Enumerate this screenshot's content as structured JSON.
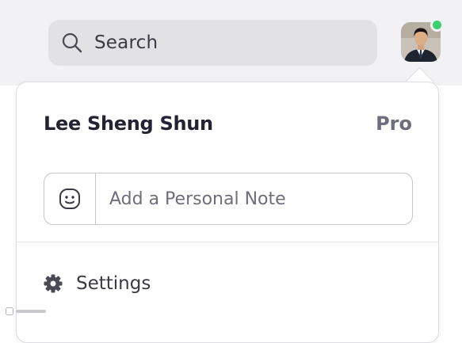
{
  "topbar": {
    "search": {
      "label": "Search",
      "icon": "search-icon"
    },
    "avatar": {
      "icon": "avatar-photo",
      "status": "online",
      "status_color": "#3bd06f"
    }
  },
  "profile_menu": {
    "user_name": "Lee Sheng Shun",
    "plan": "Pro",
    "personal_note": {
      "placeholder": "Add a Personal Note",
      "value": "",
      "icon": "smiley-icon"
    },
    "items": [
      {
        "label": "Settings",
        "icon": "gear-icon"
      }
    ]
  },
  "colors": {
    "topbar_bg": "#f2f2f4",
    "search_bg": "#e1e1e6",
    "text_primary": "#232333",
    "text_secondary": "#6e6e7a"
  }
}
